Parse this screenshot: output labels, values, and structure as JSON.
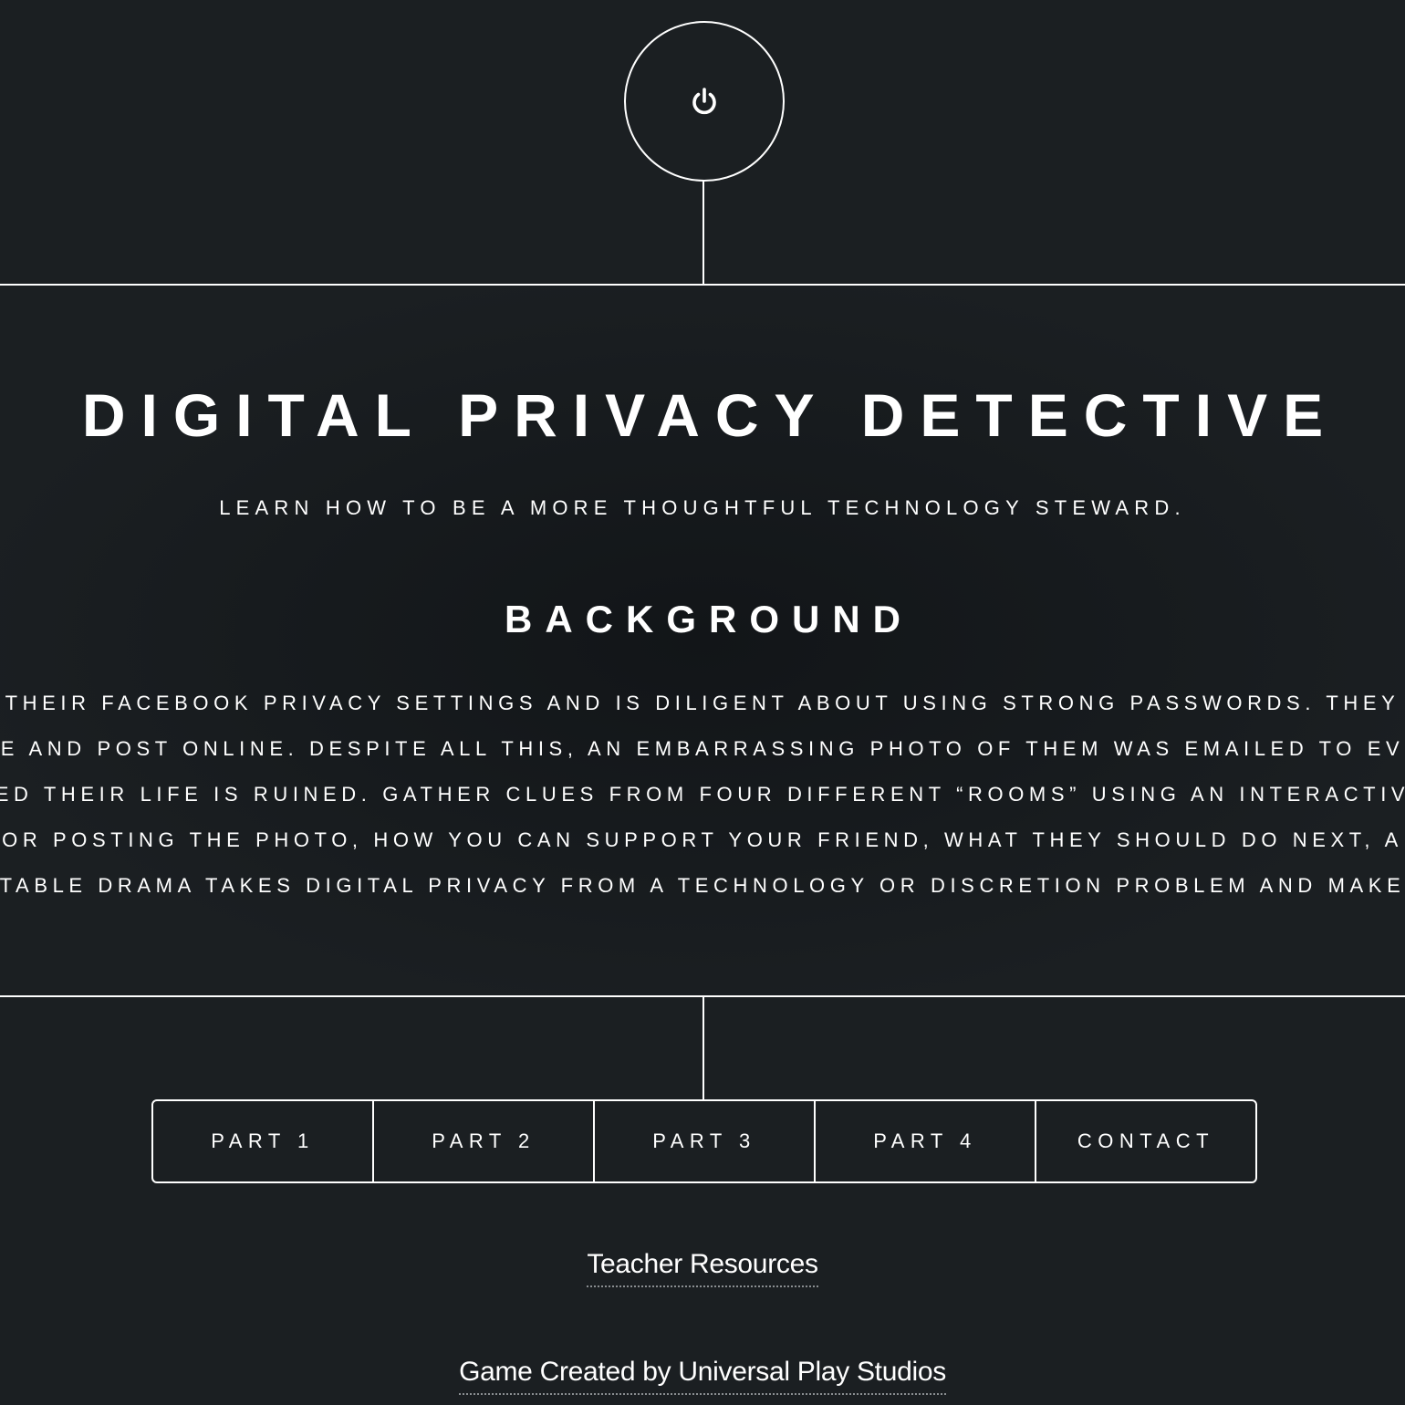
{
  "header": {
    "logo_icon": "power-icon"
  },
  "intro": {
    "title": "DIGITAL PRIVACY DETECTIVE",
    "subtitle": "LEARN HOW TO BE A MORE THOUGHTFUL TECHNOLOGY STEWARD."
  },
  "background": {
    "heading": "BACKGROUND",
    "lines": [
      "THEIR FACEBOOK PRIVACY SETTINGS AND IS DILIGENT ABOUT USING STRONG PASSWORDS. THEY",
      "E AND POST ONLINE. DESPITE ALL THIS, AN EMBARRASSING PHOTO OF THEM WAS EMAILED TO EV",
      "ED THEIR LIFE IS RUINED. GATHER CLUES FROM FOUR DIFFERENT “ROOMS” USING AN INTERACTIV",
      "OR POSTING THE PHOTO, HOW YOU CAN SUPPORT YOUR FRIEND, WHAT THEY SHOULD DO NEXT, A",
      "TABLE DRAMA TAKES DIGITAL PRIVACY FROM A TECHNOLOGY OR DISCRETION PROBLEM AND MAKE"
    ]
  },
  "nav": {
    "items": [
      {
        "label": "PART 1"
      },
      {
        "label": "PART 2"
      },
      {
        "label": "PART 3"
      },
      {
        "label": "PART 4"
      },
      {
        "label": "CONTACT"
      }
    ]
  },
  "footer": {
    "teacher_link": "Teacher Resources",
    "credit_link": "Game Created by Universal Play Studios"
  },
  "colors": {
    "background": "#1b1f22",
    "foreground": "#ffffff",
    "link_underline": "#8a8e91"
  }
}
